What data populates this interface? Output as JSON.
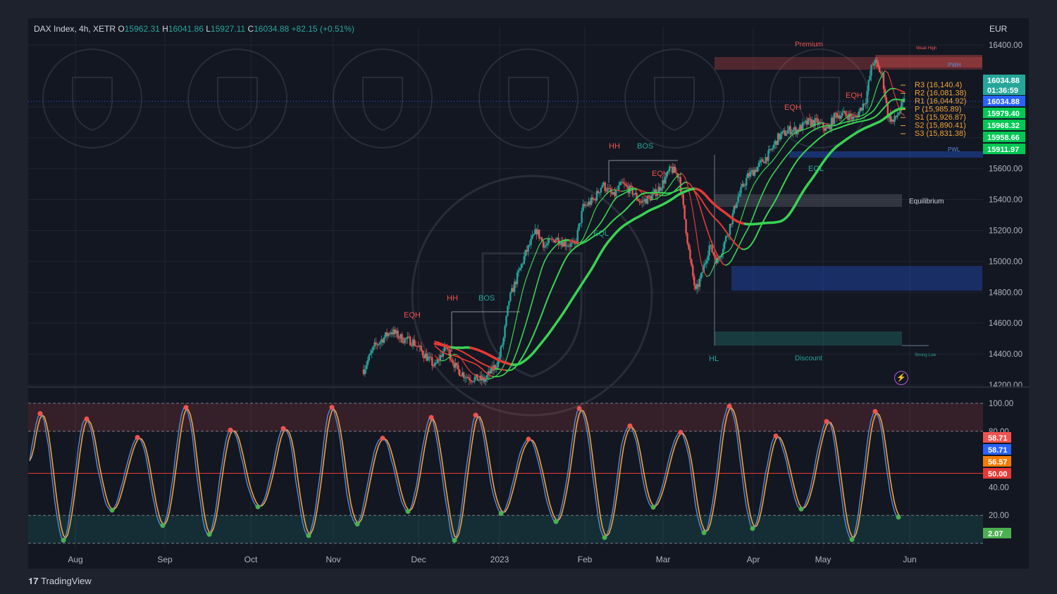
{
  "legend": {
    "symbol": "DAX Index, 4h, XETR",
    "o_label": "O",
    "o": "15962.31",
    "h_label": "H",
    "h": "16041.86",
    "l_label": "L",
    "l": "15927.11",
    "c_label": "C",
    "c": "16034.88",
    "change": "+82.15 (+0.51%)"
  },
  "currency": "EUR",
  "brand": "TradingView",
  "colors": {
    "background": "#131722",
    "up": "#26a69a",
    "down": "#ef5350",
    "ma_green": "#39d353",
    "ma_red": "#e53935",
    "stoch_k": "#5b8bd9",
    "stoch_d": "#f2a43a"
  },
  "chart_data": [
    {
      "type": "candlestick",
      "x_ticks": [
        "Aug",
        "Sep",
        "Oct",
        "Nov",
        "Dec",
        "2023",
        "Feb",
        "Mar",
        "Apr",
        "May",
        "Jun"
      ],
      "y_ticks": [
        "16400.00",
        "16000.00",
        "15800.00",
        "15600.00",
        "15400.00",
        "15200.00",
        "15000.00",
        "14800.00",
        "14600.00",
        "14400.00",
        "14200.00"
      ],
      "ylim": [
        14200,
        16500
      ],
      "price_tags": [
        {
          "value": "16034.88",
          "color": "#26a69a"
        },
        {
          "value": "01:36:59",
          "color": "#26a69a"
        },
        {
          "value": "16034.88",
          "color": "#2962ff"
        },
        {
          "value": "15979.40",
          "color": "#00c853"
        },
        {
          "value": "15968.32",
          "color": "#00c853"
        },
        {
          "value": "15958.66",
          "color": "#00c853"
        },
        {
          "value": "15911.97",
          "color": "#00c853"
        }
      ],
      "pivots": [
        {
          "label": "R3 (16,140.4)",
          "value": 16140.4
        },
        {
          "label": "R2 (16,081.38)",
          "value": 16081.38
        },
        {
          "label": "R1 (16,044.92)",
          "value": 16044.92
        },
        {
          "label": "P (15,985.89)",
          "value": 15985.89
        },
        {
          "label": "S1 (15,926.87)",
          "value": 15926.87
        },
        {
          "label": "S2 (15,890.41)",
          "value": 15890.41
        },
        {
          "label": "S3 (15,831.38)",
          "value": 15831.38
        }
      ],
      "zone_labels": [
        "Premium",
        "Equilibrium",
        "Discount",
        "Weak High",
        "Strong Low",
        "PWH",
        "PWL"
      ],
      "structure_labels": [
        "HH",
        "BOS",
        "EQH",
        "HH",
        "BOS",
        "EQH",
        "EQL",
        "EQH",
        "EQH",
        "EQL",
        "HL"
      ],
      "path": [
        [
          "Jul 25",
          14200
        ],
        [
          "Aug 1",
          14200
        ],
        [
          "Aug 8",
          14200
        ],
        [
          "Aug 15",
          14200
        ],
        [
          "Aug 22",
          14200
        ],
        [
          "Aug 29",
          14200
        ],
        [
          "Sep 5",
          14200
        ],
        [
          "Sep 12",
          14200
        ],
        [
          "Sep 19",
          14200
        ],
        [
          "Sep 26",
          14200
        ],
        [
          "Oct 3",
          14200
        ],
        [
          "Oct 10",
          14200
        ],
        [
          "Oct 17",
          14200
        ],
        [
          "Oct 24",
          14200
        ],
        [
          "Oct 31",
          14200
        ],
        [
          "Nov 7",
          14200
        ],
        [
          "Nov 14",
          14300
        ],
        [
          "Nov 18",
          14450
        ],
        [
          "Nov 24",
          14550
        ],
        [
          "Nov 28",
          14500
        ],
        [
          "Dec 2",
          14480
        ],
        [
          "Dec 6",
          14400
        ],
        [
          "Dec 10",
          14320
        ],
        [
          "Dec 14",
          14450
        ],
        [
          "Dec 18",
          14300
        ],
        [
          "Dec 22",
          14250
        ],
        [
          "Dec 28",
          14230
        ],
        [
          "Jan 2",
          14350
        ],
        [
          "Jan 4",
          14500
        ],
        [
          "Jan 6",
          14750
        ],
        [
          "Jan 9",
          14900
        ],
        [
          "Jan 12",
          15050
        ],
        [
          "Jan 16",
          15200
        ],
        [
          "Jan 19",
          15100
        ],
        [
          "Jan 23",
          15150
        ],
        [
          "Jan 26",
          15120
        ],
        [
          "Jan 30",
          15100
        ],
        [
          "Feb 2",
          15350
        ],
        [
          "Feb 6",
          15400
        ],
        [
          "Feb 9",
          15500
        ],
        [
          "Feb 13",
          15420
        ],
        [
          "Feb 16",
          15500
        ],
        [
          "Feb 20",
          15450
        ],
        [
          "Feb 23",
          15380
        ],
        [
          "Feb 27",
          15420
        ],
        [
          "Mar 2",
          15480
        ],
        [
          "Mar 6",
          15600
        ],
        [
          "Mar 9",
          15550
        ],
        [
          "Mar 13",
          15000
        ],
        [
          "Mar 15",
          14800
        ],
        [
          "Mar 17",
          14900
        ],
        [
          "Mar 20",
          15100
        ],
        [
          "Mar 23",
          15000
        ],
        [
          "Mar 27",
          15200
        ],
        [
          "Mar 30",
          15400
        ],
        [
          "Apr 3",
          15550
        ],
        [
          "Apr 6",
          15600
        ],
        [
          "Apr 11",
          15700
        ],
        [
          "Apr 14",
          15800
        ],
        [
          "Apr 18",
          15850
        ],
        [
          "Apr 21",
          15850
        ],
        [
          "Apr 25",
          15900
        ],
        [
          "Apr 28",
          15900
        ],
        [
          "May 2",
          15850
        ],
        [
          "May 5",
          15950
        ],
        [
          "May 9",
          15950
        ],
        [
          "May 12",
          15920
        ],
        [
          "May 16",
          16050
        ],
        [
          "May 18",
          16250
        ],
        [
          "May 19",
          16300
        ],
        [
          "May 22",
          16200
        ],
        [
          "May 24",
          15950
        ],
        [
          "May 26",
          15900
        ],
        [
          "May 29",
          16000
        ],
        [
          "May 30",
          16035
        ]
      ]
    },
    {
      "type": "line",
      "name": "Stochastic",
      "y_ticks": [
        "100.00",
        "80.00",
        "40.00",
        "20.00"
      ],
      "ylim": [
        0,
        100
      ],
      "overbought": 80,
      "oversold": 20,
      "midline": 50,
      "value_tags": [
        {
          "value": "58.71",
          "color": "#ef5350"
        },
        {
          "value": "58.71",
          "color": "#2962ff"
        },
        {
          "value": "56.57",
          "color": "#f57c00"
        },
        {
          "value": "50.00",
          "color": "#e53935"
        },
        {
          "value": "2.07",
          "color": "#4caf50"
        }
      ]
    }
  ]
}
